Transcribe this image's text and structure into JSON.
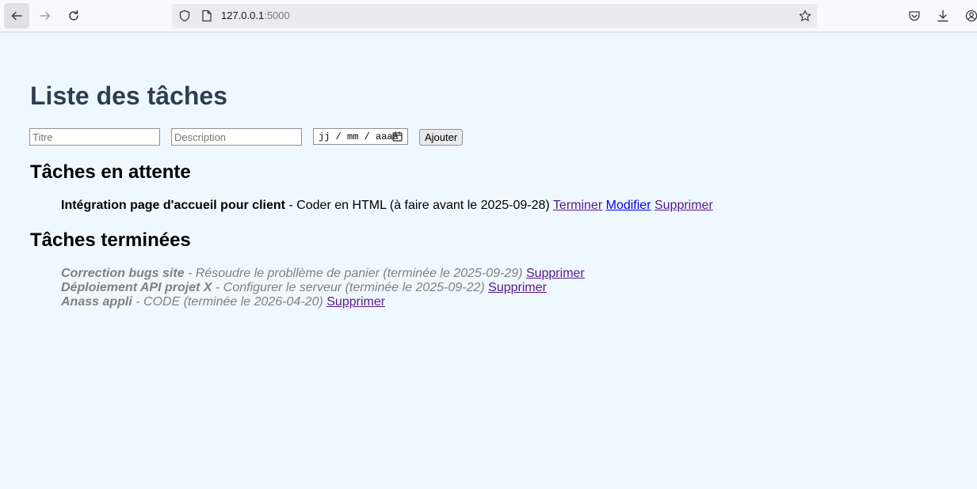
{
  "browser": {
    "url_host": "127.0.0.1",
    "url_port": ":5000"
  },
  "page": {
    "title": "Liste des tâches"
  },
  "form": {
    "title_placeholder": "Titre",
    "description_placeholder": "Description",
    "date_placeholder": "jj / mm / aaaa",
    "add_label": "Ajouter"
  },
  "pending": {
    "heading": "Tâches en attente",
    "items": [
      {
        "title": "Intégration page d'accueil pour client",
        "details": " - Coder en HTML (à faire avant le 2025-09-28)",
        "complete_label": "Terminer",
        "edit_label": "Modifier",
        "delete_label": "Supprimer"
      }
    ]
  },
  "done": {
    "heading": "Tâches terminées",
    "items": [
      {
        "title": "Correction bugs site",
        "details": " - Résoudre le probllème de panier (terminée le 2025-09-29)",
        "delete_label": "Supprimer"
      },
      {
        "title": "Déploiement API projet X",
        "details": " - Configurer le serveur (terminée le 2025-09-22)",
        "delete_label": "Supprimer"
      },
      {
        "title": "Anass appli",
        "details": " - CODE (terminée le 2026-04-20)",
        "delete_label": "Supprimer"
      }
    ]
  },
  "colors": {
    "background": "#f0f8ff",
    "title": "#2c3e50",
    "done_text": "#808080",
    "visited_link": "#551a8b",
    "link": "#0000ee"
  }
}
